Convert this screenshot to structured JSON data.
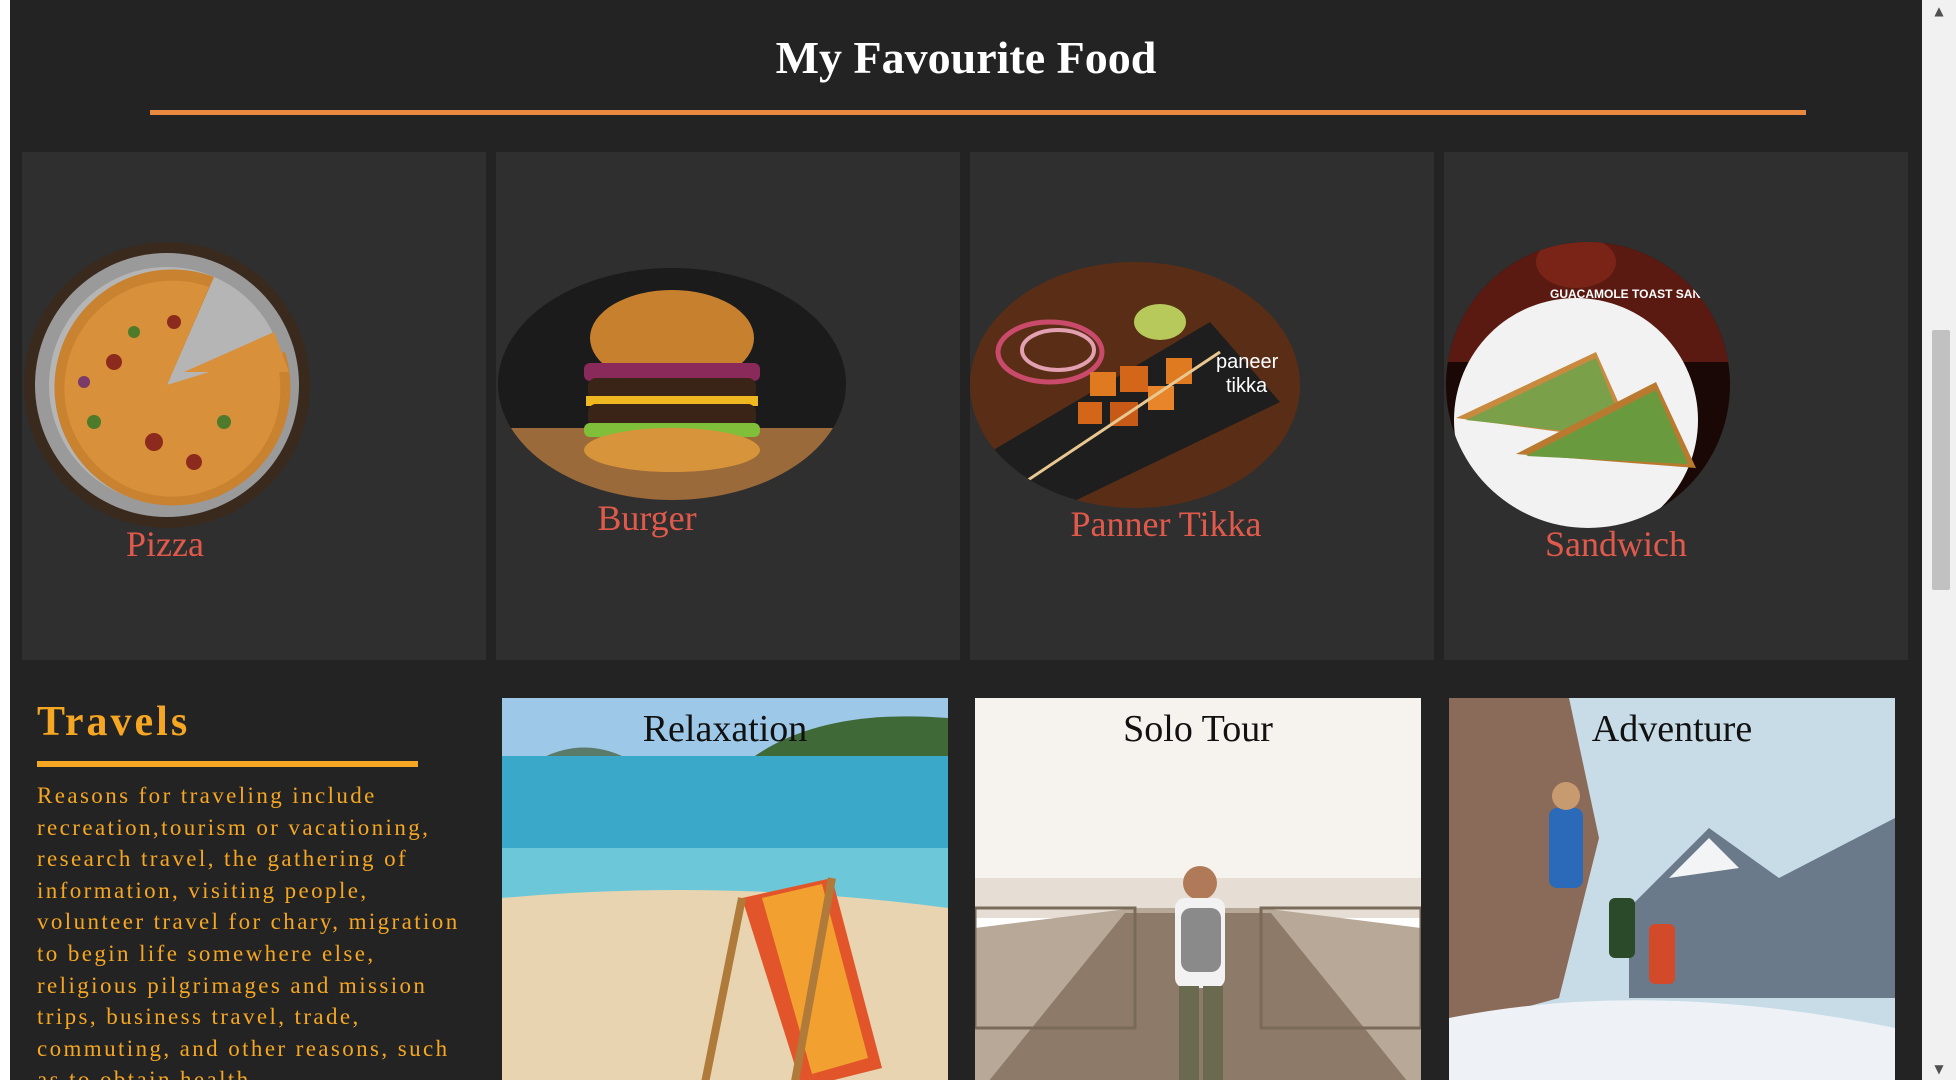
{
  "food_section": {
    "title": "My Favourite Food",
    "items": [
      {
        "label": "Pizza"
      },
      {
        "label": "Burger"
      },
      {
        "label": "Panner Tikka"
      },
      {
        "label": "Sandwich"
      }
    ],
    "image_texts": {
      "paneer": "paneer",
      "tikka": "tikka",
      "sandwich_banner": "GUACAMOLE TOAST SAND"
    }
  },
  "travels_section": {
    "title": "Travels",
    "description": "Reasons for traveling include recreation,tourism or vacationing, research travel, the gathering of information, visiting people, volunteer travel for chary, migration to begin life somewhere else, religious pilgrimages and mission trips, business travel, trade, commuting, and other reasons, such as to obtain health",
    "cards": [
      {
        "label": "Relaxation"
      },
      {
        "label": "Solo Tour"
      },
      {
        "label": "Adventure"
      }
    ]
  },
  "colors": {
    "page_background": "#232323",
    "card_background": "#2f2f2f",
    "food_divider": "#e8893f",
    "accent_orange": "#f5a623",
    "food_label": "#e05a4c"
  },
  "scrollbar": {
    "up_icon": "scroll-up-arrow-icon",
    "down_icon": "scroll-down-arrow-icon"
  }
}
